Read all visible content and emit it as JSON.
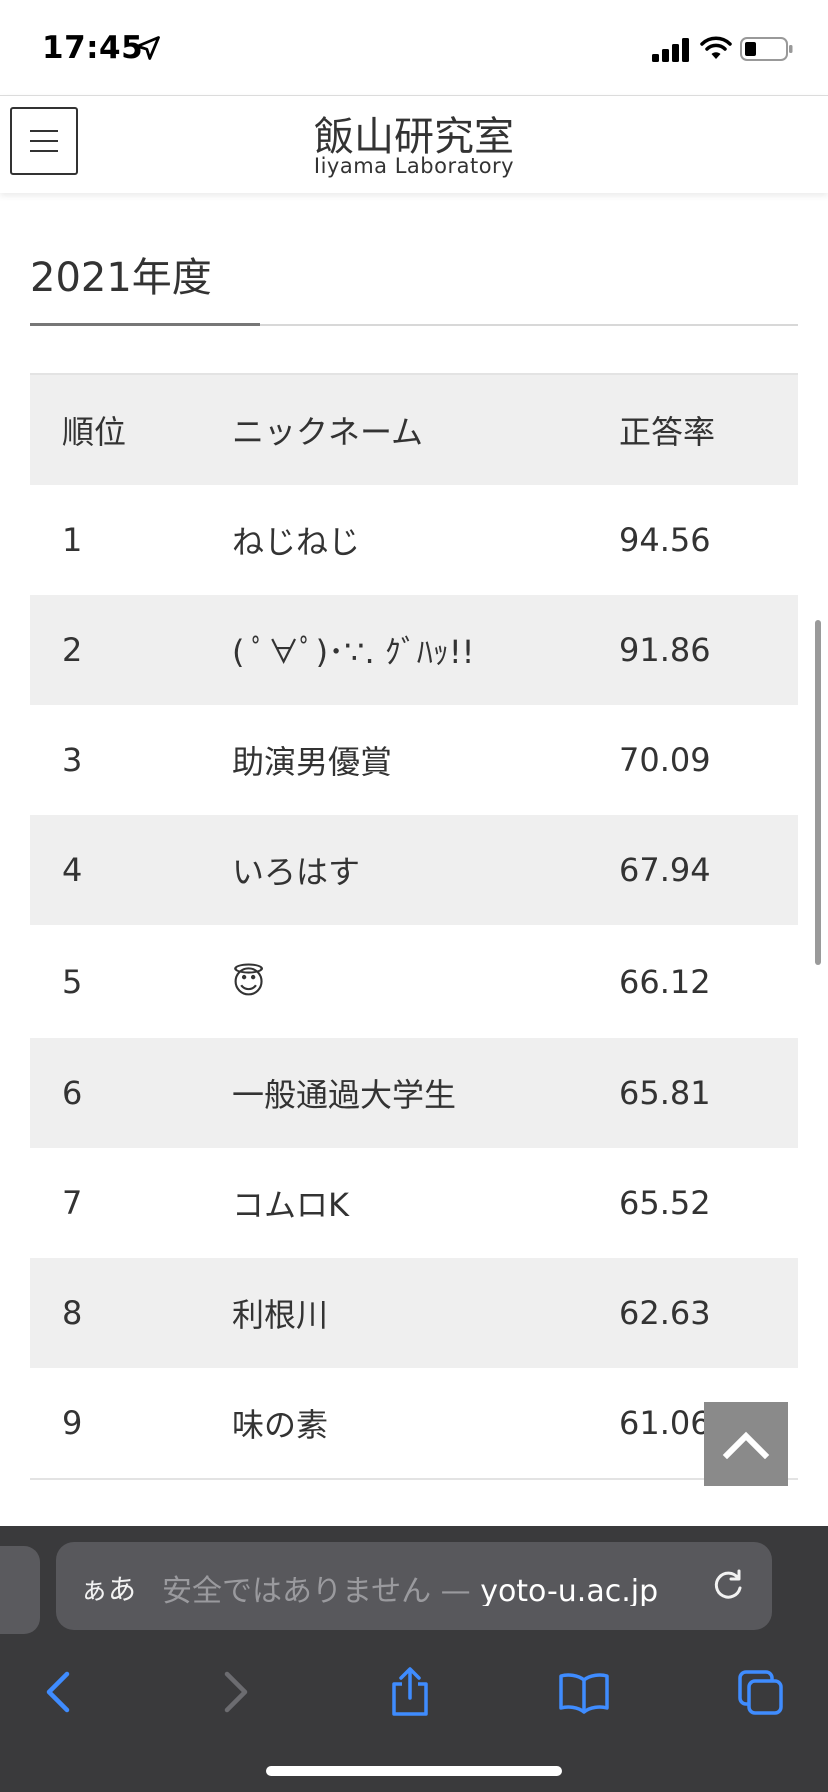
{
  "status_bar": {
    "time": "17:45",
    "icons": [
      "location-arrow-icon",
      "cellular-signal-icon",
      "wifi-icon",
      "battery-icon"
    ]
  },
  "header": {
    "title": "飯山研究室",
    "subtitle": "Iiyama Laboratory",
    "menu_icon": "hamburger-menu-icon"
  },
  "section": {
    "title": "2021年度"
  },
  "table": {
    "columns": [
      "順位",
      "ニックネーム",
      "正答率"
    ],
    "rows": [
      {
        "rank": "1",
        "nickname": "ねじねじ",
        "rate": "94.56"
      },
      {
        "rank": "2",
        "nickname": "( ﾟ∀ﾟ)･∵. ｸﾞﾊｯ!!",
        "rate": "91.86"
      },
      {
        "rank": "3",
        "nickname": "助演男優賞",
        "rate": "70.09"
      },
      {
        "rank": "4",
        "nickname": "いろはす",
        "rate": "67.94"
      },
      {
        "rank": "5",
        "nickname": "😇",
        "rate": "66.12"
      },
      {
        "rank": "6",
        "nickname": "一般通過大学生",
        "rate": "65.81"
      },
      {
        "rank": "7",
        "nickname": "コムロK",
        "rate": "65.52"
      },
      {
        "rank": "8",
        "nickname": "利根川",
        "rate": "62.63"
      },
      {
        "rank": "9",
        "nickname": "味の素",
        "rate": "61.06"
      }
    ]
  },
  "browser": {
    "aa_label": "ぁあ",
    "url_insecure_label": "安全ではありません — ",
    "url_domain": "yoto-u.ac.jp",
    "nav_icons": [
      "back-arrow-icon",
      "forward-arrow-icon",
      "share-icon",
      "bookmarks-icon",
      "tabs-icon"
    ]
  },
  "colors": {
    "row_shade": "#efefef",
    "toolbar": "#3a3a3c",
    "safari_blue": "#3f8cff"
  }
}
